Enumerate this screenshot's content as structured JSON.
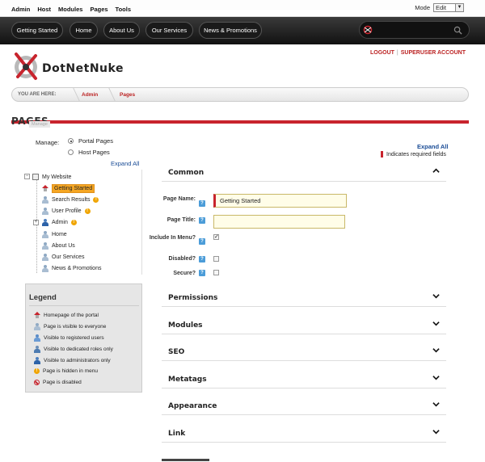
{
  "control_bar": {
    "menu": [
      "Admin",
      "Host",
      "Modules",
      "Pages",
      "Tools"
    ],
    "mode_label": "Mode",
    "mode_value": "Edit"
  },
  "nav": {
    "items": [
      "Getting Started",
      "Home",
      "About Us",
      "Our Services",
      "News & Promotions"
    ]
  },
  "logo": {
    "text": "DotNetNuke"
  },
  "user_links": {
    "logout": "LOGOUT",
    "separator": "|",
    "account": "SUPERUSER ACCOUNT"
  },
  "breadcrumb": {
    "label": "YOU ARE HERE:",
    "items": [
      "Admin",
      "Pages"
    ]
  },
  "page": {
    "title": "PAGES",
    "title_tag": "Manage"
  },
  "manage": {
    "label": "Manage:",
    "options": [
      "Portal Pages",
      "Host Pages"
    ],
    "selected": "Portal Pages"
  },
  "expand_all": "Expand All",
  "required_note": "Indicates required fields",
  "tree": {
    "root": "My Website",
    "items": [
      {
        "label": "Getting Started",
        "selected": true,
        "icon": "home-icon"
      },
      {
        "label": "Search Results",
        "warn": true,
        "icon": "person-icon"
      },
      {
        "label": "User Profile",
        "warn": true,
        "icon": "person-icon"
      },
      {
        "label": "Admin",
        "warn": true,
        "icon": "admin-icon",
        "collapsed": true
      },
      {
        "label": "Home",
        "icon": "person-icon"
      },
      {
        "label": "About Us",
        "icon": "person-icon"
      },
      {
        "label": "Our Services",
        "icon": "person-icon"
      },
      {
        "label": "News & Promotions",
        "icon": "person-icon"
      }
    ]
  },
  "legend": {
    "title": "Legend",
    "items": [
      "Homepage of the portal",
      "Page is visible to everyone",
      "Visible to registered users",
      "Visible to dedicated roles only",
      "Visible to administrators only",
      "Page is hidden in menu",
      "Page is disabled"
    ]
  },
  "form": {
    "common_title": "Common",
    "page_name_label": "Page Name:",
    "page_name_value": "Getting Started",
    "page_title_label": "Page Title:",
    "page_title_value": "",
    "include_in_menu_label": "Include In Menu?",
    "include_in_menu": true,
    "disabled_label": "Disabled?",
    "disabled": false,
    "secure_label": "Secure?",
    "secure": false,
    "help_glyph": "?",
    "sections": [
      "Permissions",
      "Modules",
      "SEO",
      "Metatags",
      "Appearance",
      "Link"
    ]
  },
  "colors": {
    "accent": "#c8242d",
    "link": "#1a4c96",
    "selected": "#f5a623"
  }
}
